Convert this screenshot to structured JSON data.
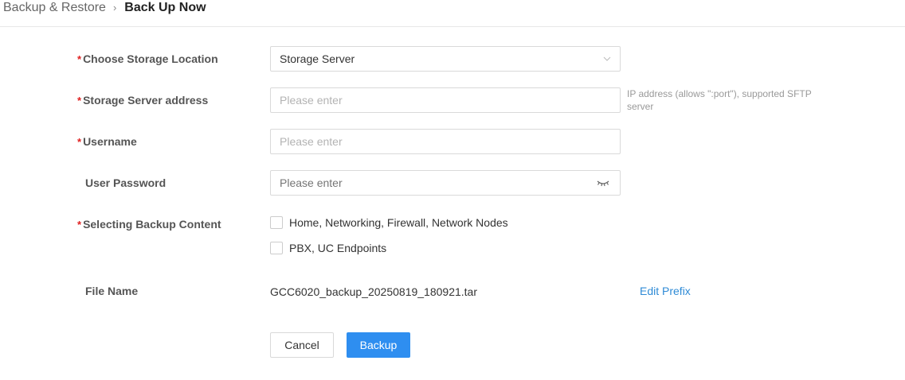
{
  "breadcrumb": {
    "parent": "Backup & Restore",
    "separator": "›",
    "current": "Back Up Now"
  },
  "form": {
    "storage_location": {
      "label": "Choose Storage Location",
      "value": "Storage Server",
      "required": true
    },
    "server_address": {
      "label": "Storage Server address",
      "placeholder": "Please enter",
      "hint": "IP address (allows \":port\"), supported SFTP server",
      "required": true
    },
    "username": {
      "label": "Username",
      "placeholder": "Please enter",
      "required": true
    },
    "password": {
      "label": "User Password",
      "placeholder": "Please enter",
      "required": false
    },
    "backup_content": {
      "label": "Selecting Backup Content",
      "required": true,
      "options": [
        {
          "label": "Home, Networking, Firewall, Network Nodes",
          "checked": false
        },
        {
          "label": "PBX, UC Endpoints",
          "checked": false
        }
      ]
    },
    "file_name": {
      "label": "File Name",
      "value": "GCC6020_backup_20250819_180921.tar",
      "edit_link": "Edit Prefix"
    }
  },
  "actions": {
    "cancel": "Cancel",
    "backup": "Backup"
  },
  "colors": {
    "primary": "#2e8ef0",
    "link": "#2f8bd6",
    "required": "#e02020"
  }
}
